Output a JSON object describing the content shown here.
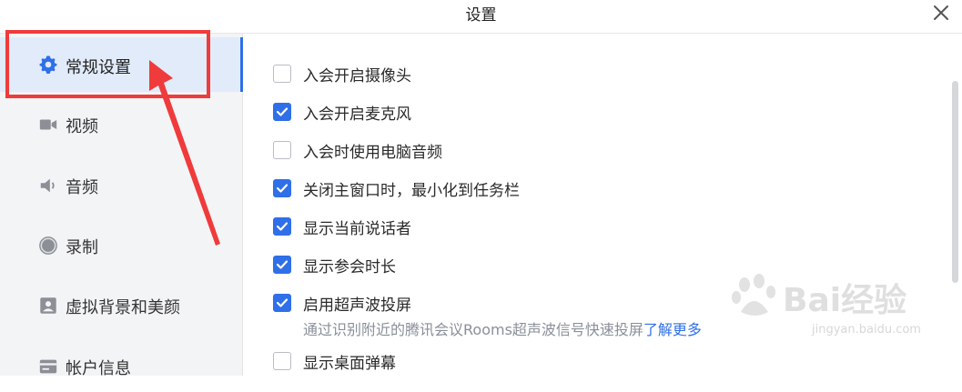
{
  "window": {
    "title": "设置",
    "close_icon": "close-icon"
  },
  "sidebar": {
    "items": [
      {
        "label": "常规设置",
        "icon": "gear-icon",
        "active": true
      },
      {
        "label": "视频",
        "icon": "video-camera-icon",
        "active": false
      },
      {
        "label": "音频",
        "icon": "speaker-icon",
        "active": false
      },
      {
        "label": "录制",
        "icon": "record-icon",
        "active": false
      },
      {
        "label": "虚拟背景和美颜",
        "icon": "portrait-icon",
        "active": false
      },
      {
        "label": "帐户信息",
        "icon": "account-card-icon",
        "active": false
      }
    ]
  },
  "general_settings": {
    "options": [
      {
        "label": "入会开启摄像头",
        "checked": false
      },
      {
        "label": "入会开启麦克风",
        "checked": true
      },
      {
        "label": "入会时使用电脑音频",
        "checked": false
      },
      {
        "label": "关闭主窗口时，最小化到任务栏",
        "checked": true
      },
      {
        "label": "显示当前说话者",
        "checked": true
      },
      {
        "label": "显示参会时长",
        "checked": true
      },
      {
        "label": "启用超声波投屏",
        "checked": true
      },
      {
        "label": "显示桌面弹幕",
        "checked": false
      }
    ],
    "ultrasonic_description": "通过识别附近的腾讯会议Rooms超声波信号快速投屏",
    "learn_more_label": "了解更多"
  },
  "colors": {
    "accent": "#2f6fe8",
    "annotation_red": "#ef3b3b",
    "sidebar_bg": "#f3f4f6",
    "active_bg": "#e1ebfa"
  },
  "watermark": {
    "brand": "Bai经验",
    "url": "jingyan.baidu.com"
  }
}
